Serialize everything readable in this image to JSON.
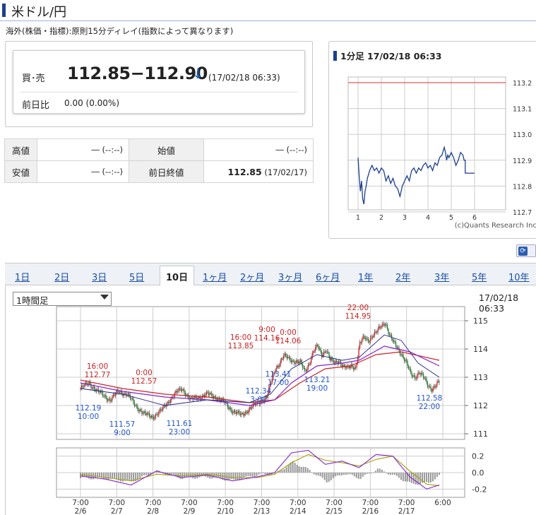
{
  "header": {
    "title": "米ドル/円"
  },
  "note": "海外(株価・指標):原則15分ディレイ(指数によって異なります)",
  "price": {
    "bid_label": "買･売",
    "bid_ask": "112.85−112.90",
    "arrow": "↓",
    "time": "(17/02/18 06:33)",
    "change_label": "前日比",
    "change": "0.00 (0.00%)"
  },
  "stats": {
    "high_label": "高値",
    "high": "― (--:--)",
    "open_label": "始値",
    "open": "― (--:--)",
    "low_label": "安値",
    "low": "― (--:--)",
    "prev_close_label": "前日終値",
    "prev_close": "112.85",
    "prev_close_date": " (17/02/17)"
  },
  "mini_chart": {
    "title": "1分足 17/02/18 06:33",
    "credit": "(c)Quants Research Inc.",
    "y_ticks": [
      "113.2",
      "113.1",
      "113.0",
      "112.9",
      "112.8",
      "112.7"
    ],
    "x_ticks": [
      "1",
      "2",
      "3",
      "4",
      "5",
      "6"
    ],
    "ref_line": 113.2,
    "series": [
      [
        0.0,
        112.91
      ],
      [
        0.05,
        112.84
      ],
      [
        0.1,
        112.78
      ],
      [
        0.15,
        112.82
      ],
      [
        0.2,
        112.75
      ],
      [
        0.25,
        112.73
      ],
      [
        0.3,
        112.78
      ],
      [
        0.35,
        112.8
      ],
      [
        0.4,
        112.83
      ],
      [
        0.5,
        112.86
      ],
      [
        0.6,
        112.88
      ],
      [
        0.7,
        112.86
      ],
      [
        0.8,
        112.87
      ],
      [
        0.9,
        112.85
      ],
      [
        1.0,
        112.87
      ],
      [
        1.1,
        112.86
      ],
      [
        1.2,
        112.82
      ],
      [
        1.3,
        112.84
      ],
      [
        1.4,
        112.81
      ],
      [
        1.5,
        112.83
      ],
      [
        1.6,
        112.8
      ],
      [
        1.7,
        112.79
      ],
      [
        1.8,
        112.76
      ],
      [
        1.9,
        112.8
      ],
      [
        2.0,
        112.82
      ],
      [
        2.1,
        112.84
      ],
      [
        2.2,
        112.82
      ],
      [
        2.3,
        112.86
      ],
      [
        2.4,
        112.87
      ],
      [
        2.5,
        112.85
      ],
      [
        2.6,
        112.87
      ],
      [
        2.7,
        112.86
      ],
      [
        2.8,
        112.88
      ],
      [
        2.9,
        112.89
      ],
      [
        3.0,
        112.87
      ],
      [
        3.1,
        112.88
      ],
      [
        3.2,
        112.86
      ],
      [
        3.3,
        112.89
      ],
      [
        3.4,
        112.88
      ],
      [
        3.5,
        112.91
      ],
      [
        3.6,
        112.92
      ],
      [
        3.7,
        112.95
      ],
      [
        3.75,
        112.93
      ],
      [
        3.8,
        112.9
      ],
      [
        3.85,
        112.92
      ],
      [
        3.9,
        112.91
      ],
      [
        4.0,
        112.93
      ],
      [
        4.1,
        112.91
      ],
      [
        4.2,
        112.88
      ],
      [
        4.3,
        112.9
      ],
      [
        4.4,
        112.93
      ],
      [
        4.5,
        112.92
      ],
      [
        4.55,
        112.9
      ],
      [
        4.6,
        112.9
      ],
      [
        4.6,
        112.85
      ],
      [
        5.0,
        112.85
      ]
    ]
  },
  "refresh_label": "更新",
  "tabs": [
    "1日",
    "2日",
    "3日",
    "5日",
    "10日",
    "1ヶ月",
    "2ヶ月",
    "3ヶ月",
    "6ヶ月",
    "1年",
    "2年",
    "3年",
    "5年",
    "10年"
  ],
  "active_tab": 4,
  "select": {
    "value": "1時間足"
  },
  "chart_timestamp": "17/02/18 06:33",
  "chart_data": {
    "type": "candlestick",
    "price_y_ticks": [
      115,
      114,
      113,
      112,
      111
    ],
    "ylim": [
      110.8,
      115.5
    ],
    "oscillator_ticks": [
      "0.2",
      "0.0",
      "-0.2"
    ],
    "oscillator_ylim": [
      -0.3,
      0.3
    ],
    "x_ticks": [
      {
        "time": "7:00",
        "date": "2/6"
      },
      {
        "time": "7:00",
        "date": "2/7"
      },
      {
        "time": "7:00",
        "date": "2/8"
      },
      {
        "time": "7:00",
        "date": "2/9"
      },
      {
        "time": "7:00",
        "date": "2/10"
      },
      {
        "time": "7:00",
        "date": "2/13"
      },
      {
        "time": "7:00",
        "date": "2/14"
      },
      {
        "time": "7:00",
        "date": "2/15"
      },
      {
        "time": "7:00",
        "date": "2/16"
      },
      {
        "time": "7:00",
        "date": "2/17"
      },
      {
        "time": "6:00",
        "date": ""
      }
    ],
    "annotations_high": [
      {
        "time": "16:00",
        "value": "112.77"
      },
      {
        "time": "0:00",
        "value": "112.57"
      },
      {
        "time": "16:00",
        "value": "113.85"
      },
      {
        "time": "9:00",
        "value": "114.16"
      },
      {
        "time": "0:00",
        "value": "114.06"
      },
      {
        "time": "22:00",
        "value": "114.95"
      }
    ],
    "annotations_low": [
      {
        "value": "112.19",
        "time": "10:00"
      },
      {
        "value": "111.57",
        "time": "9:00"
      },
      {
        "value": "111.61",
        "time": "23:00"
      },
      {
        "value": "112.34",
        "time": "3:00"
      },
      {
        "value": "113.41",
        "time": "17:00"
      },
      {
        "value": "113.21",
        "time": "19:00"
      },
      {
        "value": "112.58",
        "time": "22:00"
      }
    ],
    "price_path": [
      [
        0,
        112.6
      ],
      [
        2,
        112.8
      ],
      [
        4,
        112.5
      ],
      [
        6,
        112.3
      ],
      [
        7,
        112.2
      ],
      [
        9,
        112.5
      ],
      [
        11,
        112.4
      ],
      [
        13,
        112.0
      ],
      [
        15,
        111.7
      ],
      [
        17,
        111.6
      ],
      [
        19,
        111.8
      ],
      [
        21,
        112.2
      ],
      [
        23,
        112.5
      ],
      [
        24,
        112.6
      ],
      [
        26,
        112.2
      ],
      [
        28,
        112.3
      ],
      [
        30,
        112.4
      ],
      [
        32,
        112.3
      ],
      [
        34,
        112.1
      ],
      [
        36,
        111.8
      ],
      [
        38,
        111.65
      ],
      [
        40,
        111.9
      ],
      [
        42,
        112.1
      ],
      [
        44,
        112.3
      ],
      [
        45,
        112.8
      ],
      [
        46,
        113.3
      ],
      [
        47,
        113.5
      ],
      [
        48,
        113.75
      ],
      [
        50,
        113.6
      ],
      [
        52,
        113.5
      ],
      [
        53,
        113.2
      ],
      [
        54,
        113.5
      ],
      [
        55,
        113.9
      ],
      [
        56,
        114.1
      ],
      [
        57,
        113.8
      ],
      [
        58,
        114.0
      ],
      [
        59,
        113.6
      ],
      [
        60,
        113.5
      ],
      [
        61,
        113.6
      ],
      [
        62,
        113.4
      ],
      [
        63,
        113.3
      ],
      [
        64,
        113.4
      ],
      [
        65,
        113.35
      ],
      [
        66,
        114.2
      ],
      [
        67,
        114.4
      ],
      [
        68,
        114.3
      ],
      [
        69,
        114.5
      ],
      [
        70,
        114.6
      ],
      [
        71,
        114.8
      ],
      [
        72,
        114.95
      ],
      [
        73,
        114.5
      ],
      [
        74,
        114.2
      ],
      [
        75,
        114.0
      ],
      [
        76,
        113.8
      ],
      [
        77,
        113.5
      ],
      [
        78,
        113.1
      ],
      [
        79,
        113.0
      ],
      [
        80,
        113.2
      ],
      [
        81,
        113.0
      ],
      [
        82,
        112.7
      ],
      [
        83,
        112.6
      ],
      [
        84,
        112.75
      ],
      [
        85,
        112.85
      ]
    ],
    "ma_short": [
      [
        0,
        112.6
      ],
      [
        10,
        112.4
      ],
      [
        20,
        112.0
      ],
      [
        30,
        112.2
      ],
      [
        40,
        112.1
      ],
      [
        45,
        112.4
      ],
      [
        50,
        113.3
      ],
      [
        56,
        113.8
      ],
      [
        62,
        113.6
      ],
      [
        66,
        113.7
      ],
      [
        72,
        114.5
      ],
      [
        76,
        114.3
      ],
      [
        80,
        113.5
      ],
      [
        85,
        113.0
      ]
    ],
    "ma_mid": [
      [
        0,
        112.8
      ],
      [
        10,
        112.5
      ],
      [
        20,
        112.3
      ],
      [
        30,
        112.2
      ],
      [
        40,
        112.0
      ],
      [
        46,
        112.2
      ],
      [
        50,
        112.8
      ],
      [
        56,
        113.4
      ],
      [
        62,
        113.5
      ],
      [
        66,
        113.6
      ],
      [
        72,
        114.1
      ],
      [
        78,
        113.9
      ],
      [
        85,
        113.4
      ]
    ],
    "ma_long": [
      [
        0,
        112.9
      ],
      [
        10,
        112.6
      ],
      [
        20,
        112.4
      ],
      [
        30,
        112.3
      ],
      [
        40,
        112.1
      ],
      [
        46,
        112.2
      ],
      [
        52,
        112.8
      ],
      [
        58,
        113.3
      ],
      [
        64,
        113.4
      ],
      [
        70,
        113.8
      ],
      [
        76,
        113.9
      ],
      [
        85,
        113.6
      ]
    ],
    "osc_macd": [
      [
        0,
        -0.04
      ],
      [
        6,
        -0.08
      ],
      [
        12,
        -0.15
      ],
      [
        18,
        0.02
      ],
      [
        24,
        -0.06
      ],
      [
        30,
        -0.03
      ],
      [
        36,
        -0.1
      ],
      [
        42,
        -0.05
      ],
      [
        46,
        0.0
      ],
      [
        50,
        0.24
      ],
      [
        54,
        0.27
      ],
      [
        58,
        0.1
      ],
      [
        62,
        0.14
      ],
      [
        66,
        0.06
      ],
      [
        70,
        0.22
      ],
      [
        74,
        0.2
      ],
      [
        78,
        -0.05
      ],
      [
        82,
        -0.2
      ],
      [
        85,
        -0.15
      ]
    ],
    "osc_signal": [
      [
        0,
        -0.02
      ],
      [
        6,
        -0.06
      ],
      [
        12,
        -0.1
      ],
      [
        18,
        -0.02
      ],
      [
        24,
        -0.04
      ],
      [
        30,
        -0.02
      ],
      [
        36,
        -0.06
      ],
      [
        42,
        -0.06
      ],
      [
        46,
        -0.02
      ],
      [
        50,
        0.12
      ],
      [
        54,
        0.22
      ],
      [
        58,
        0.15
      ],
      [
        62,
        0.12
      ],
      [
        66,
        0.08
      ],
      [
        70,
        0.16
      ],
      [
        74,
        0.2
      ],
      [
        78,
        0.02
      ],
      [
        82,
        -0.14
      ],
      [
        85,
        -0.16
      ]
    ]
  }
}
